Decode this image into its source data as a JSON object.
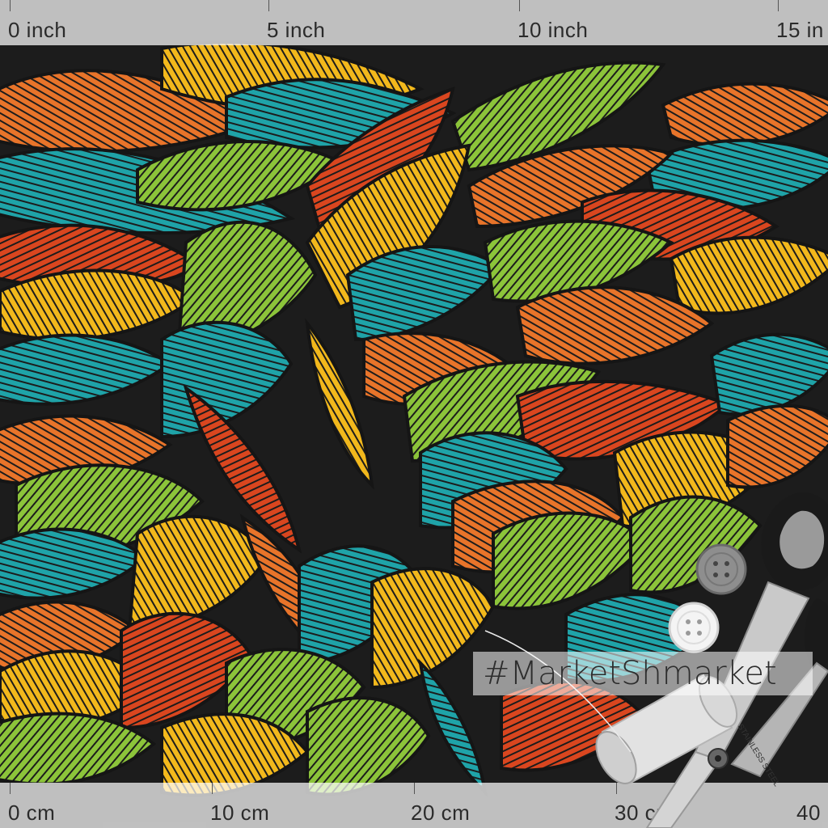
{
  "ruler_top": {
    "labels": [
      "0 inch",
      "5 inch",
      "10 inch",
      "15 in"
    ]
  },
  "ruler_bottom": {
    "labels": [
      "0 cm",
      "10 cm",
      "20 cm",
      "30 cm",
      "40"
    ]
  },
  "watermark": {
    "text": "#MarketShmarket"
  },
  "pattern": {
    "colors": [
      "#e8742a",
      "#d9461f",
      "#f2b81c",
      "#8cc43a",
      "#1fa3a8"
    ],
    "background": "#1c1c1c"
  },
  "props": {
    "scissors_engraving": "STAINLESS STEEL",
    "icons": [
      "scissors-icon",
      "button-icon",
      "thread-spool-icon"
    ]
  }
}
